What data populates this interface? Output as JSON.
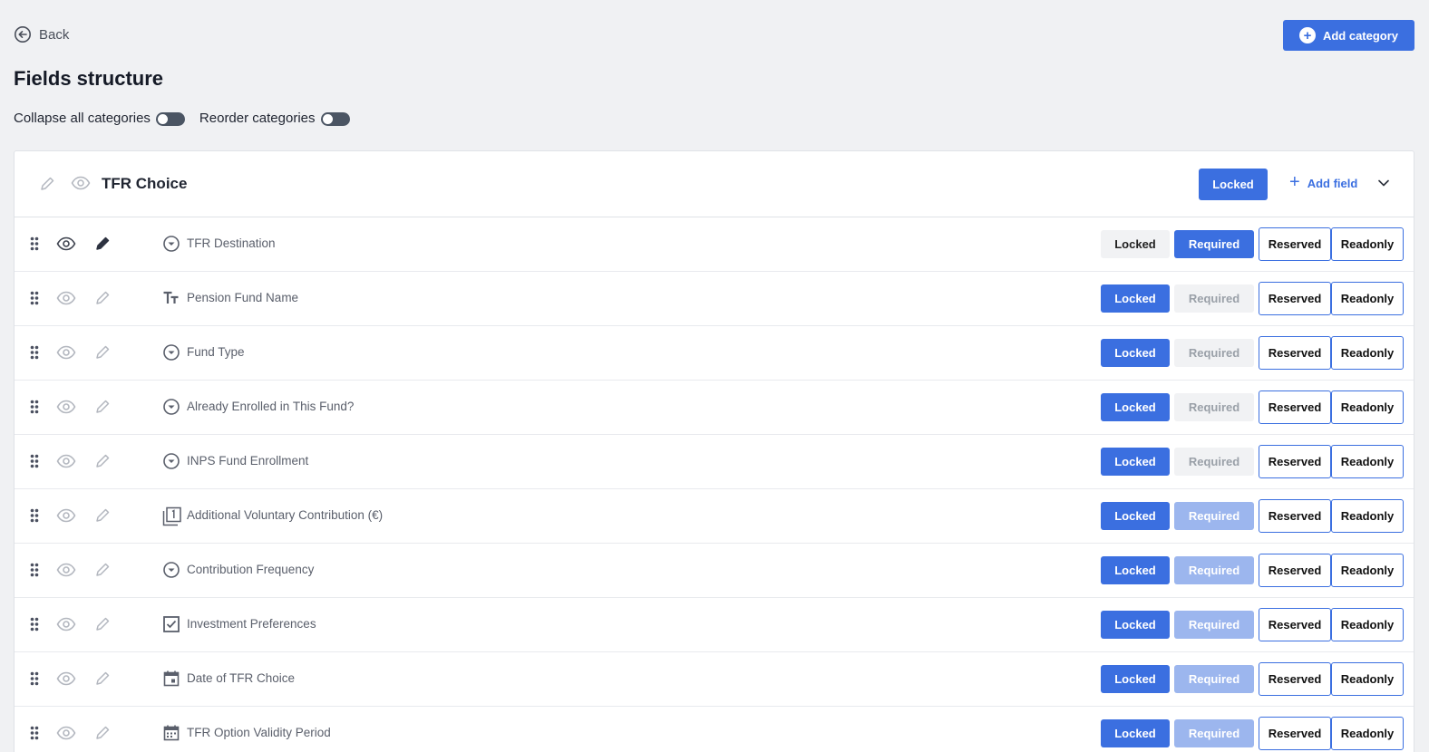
{
  "nav": {
    "back_label": "Back"
  },
  "header": {
    "add_category_label": "Add category",
    "title": "Fields structure"
  },
  "toggles": [
    {
      "label": "Collapse all categories",
      "on": false
    },
    {
      "label": "Reorder categories",
      "on": false
    }
  ],
  "category": {
    "title": "TFR Choice",
    "locked_label": "Locked",
    "add_field_label": "Add field"
  },
  "colors": {
    "accent": "#3b6fe0",
    "accent_faded": "#9cb6ee",
    "neutral_bg": "#f1f2f4"
  },
  "fields": [
    {
      "name": "TFR Destination",
      "type_icon": "dropdown-icon",
      "visible": true,
      "editable": true,
      "locked": "off",
      "required": "on",
      "reserved": "Reserved",
      "readonly": "Readonly",
      "locked_label": "Locked",
      "required_label": "Required"
    },
    {
      "name": "Pension Fund Name",
      "type_icon": "text-icon",
      "visible": false,
      "editable": false,
      "locked": "on",
      "required": "off-muted",
      "reserved": "Reserved",
      "readonly": "Readonly",
      "locked_label": "Locked",
      "required_label": "Required"
    },
    {
      "name": "Fund Type",
      "type_icon": "dropdown-icon",
      "visible": false,
      "editable": false,
      "locked": "on",
      "required": "off-muted",
      "reserved": "Reserved",
      "readonly": "Readonly",
      "locked_label": "Locked",
      "required_label": "Required"
    },
    {
      "name": "Already Enrolled in This Fund?",
      "type_icon": "dropdown-icon",
      "visible": false,
      "editable": false,
      "locked": "on",
      "required": "off-muted",
      "reserved": "Reserved",
      "readonly": "Readonly",
      "locked_label": "Locked",
      "required_label": "Required"
    },
    {
      "name": "INPS Fund Enrollment",
      "type_icon": "dropdown-icon",
      "visible": false,
      "editable": false,
      "locked": "on",
      "required": "off-muted",
      "reserved": "Reserved",
      "readonly": "Readonly",
      "locked_label": "Locked",
      "required_label": "Required"
    },
    {
      "name": "Additional Voluntary Contribution (€)",
      "type_icon": "number-icon",
      "visible": false,
      "editable": false,
      "locked": "on",
      "required": "faded",
      "reserved": "Reserved",
      "readonly": "Readonly",
      "locked_label": "Locked",
      "required_label": "Required"
    },
    {
      "name": "Contribution Frequency",
      "type_icon": "dropdown-icon",
      "visible": false,
      "editable": false,
      "locked": "on",
      "required": "faded",
      "reserved": "Reserved",
      "readonly": "Readonly",
      "locked_label": "Locked",
      "required_label": "Required"
    },
    {
      "name": "Investment Preferences",
      "type_icon": "checkbox-icon",
      "visible": false,
      "editable": false,
      "locked": "on",
      "required": "faded",
      "reserved": "Reserved",
      "readonly": "Readonly",
      "locked_label": "Locked",
      "required_label": "Required"
    },
    {
      "name": "Date of TFR Choice",
      "type_icon": "calendar-icon",
      "visible": false,
      "editable": false,
      "locked": "on",
      "required": "faded",
      "reserved": "Reserved",
      "readonly": "Readonly",
      "locked_label": "Locked",
      "required_label": "Required"
    },
    {
      "name": "TFR Option Validity Period",
      "type_icon": "date-range-icon",
      "visible": false,
      "editable": false,
      "locked": "on",
      "required": "faded",
      "reserved": "Reserved",
      "readonly": "Readonly",
      "locked_label": "Locked",
      "required_label": "Required"
    }
  ]
}
